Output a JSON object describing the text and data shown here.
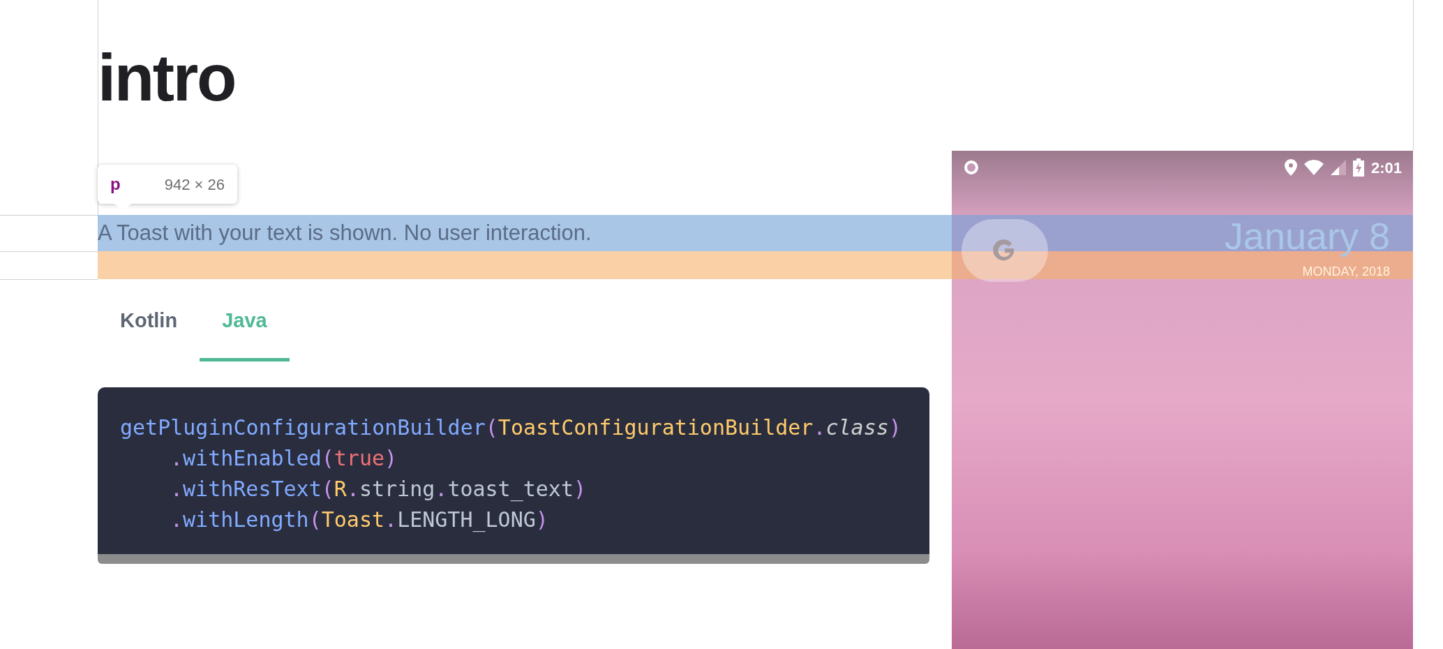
{
  "page_title": "intro",
  "inspector_tooltip": {
    "tag": "p",
    "size": "942 × 26"
  },
  "paragraph": "A Toast with your text is shown. No user interaction.",
  "tabs": [
    {
      "label": "Kotlin",
      "selected": false
    },
    {
      "label": "Java",
      "selected": true
    }
  ],
  "code_lines": [
    [
      {
        "kind": "fn",
        "text": "getPluginConfigurationBuilder"
      },
      {
        "kind": "punct",
        "text": "("
      },
      {
        "kind": "class",
        "text": "ToastConfigurationBuilder"
      },
      {
        "kind": "punct",
        "text": "."
      },
      {
        "kind": "keyword",
        "text": "class"
      },
      {
        "kind": "punct",
        "text": ")"
      }
    ],
    [
      {
        "kind": "indent"
      },
      {
        "kind": "punct",
        "text": "."
      },
      {
        "kind": "fn",
        "text": "withEnabled"
      },
      {
        "kind": "punct",
        "text": "("
      },
      {
        "kind": "bool",
        "text": "true"
      },
      {
        "kind": "punct",
        "text": ")"
      }
    ],
    [
      {
        "kind": "indent"
      },
      {
        "kind": "punct",
        "text": "."
      },
      {
        "kind": "fn",
        "text": "withResText"
      },
      {
        "kind": "punct",
        "text": "("
      },
      {
        "kind": "class",
        "text": "R"
      },
      {
        "kind": "punct",
        "text": "."
      },
      {
        "kind": "plain",
        "text": "string"
      },
      {
        "kind": "punct",
        "text": "."
      },
      {
        "kind": "plain",
        "text": "toast_text"
      },
      {
        "kind": "punct",
        "text": ")"
      }
    ],
    [
      {
        "kind": "indent"
      },
      {
        "kind": "punct",
        "text": "."
      },
      {
        "kind": "fn",
        "text": "withLength"
      },
      {
        "kind": "punct",
        "text": "("
      },
      {
        "kind": "class",
        "text": "Toast"
      },
      {
        "kind": "punct",
        "text": "."
      },
      {
        "kind": "plain",
        "text": "LENGTH_LONG"
      },
      {
        "kind": "punct",
        "text": ")"
      }
    ]
  ],
  "phone": {
    "status_time": "2:01",
    "date": "January 8",
    "weekday_year": "MONDAY, 2018"
  }
}
